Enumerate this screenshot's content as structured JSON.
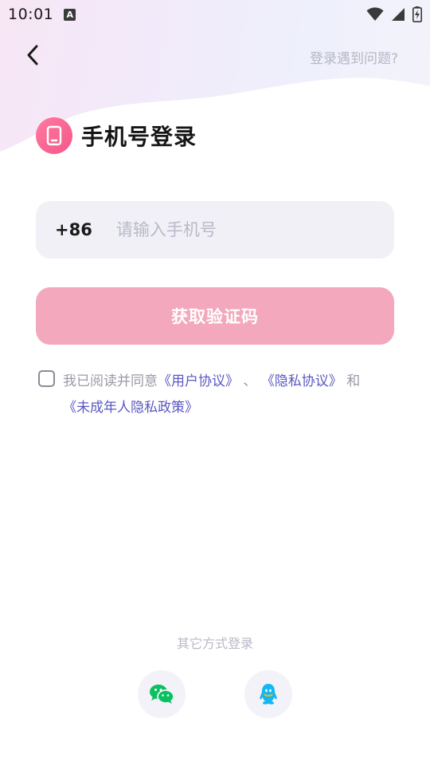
{
  "status_bar": {
    "time": "10:01",
    "notification_icon_letter": "A"
  },
  "header": {
    "help_link": "登录遇到问题?"
  },
  "title": {
    "text": "手机号登录",
    "icon_color": "#f4578a"
  },
  "phone": {
    "country_code": "+86",
    "value": "",
    "placeholder": "请输入手机号"
  },
  "code_button": {
    "label": "获取验证码",
    "color": "#f3a8bd"
  },
  "agreement": {
    "checked": false,
    "prefix": "我已阅读并同意",
    "user_agreement": "《用户协议》",
    "separator": "、",
    "privacy_agreement": "《隐私协议》",
    "and": "和",
    "minor_privacy_policy": "《未成年人隐私政策》",
    "link_color": "#5a58c2"
  },
  "other_login": {
    "title": "其它方式登录",
    "options": [
      {
        "icon": "wechat-icon",
        "color": "#09c160"
      },
      {
        "icon": "qq-icon",
        "color": "#12b7f5"
      }
    ]
  }
}
